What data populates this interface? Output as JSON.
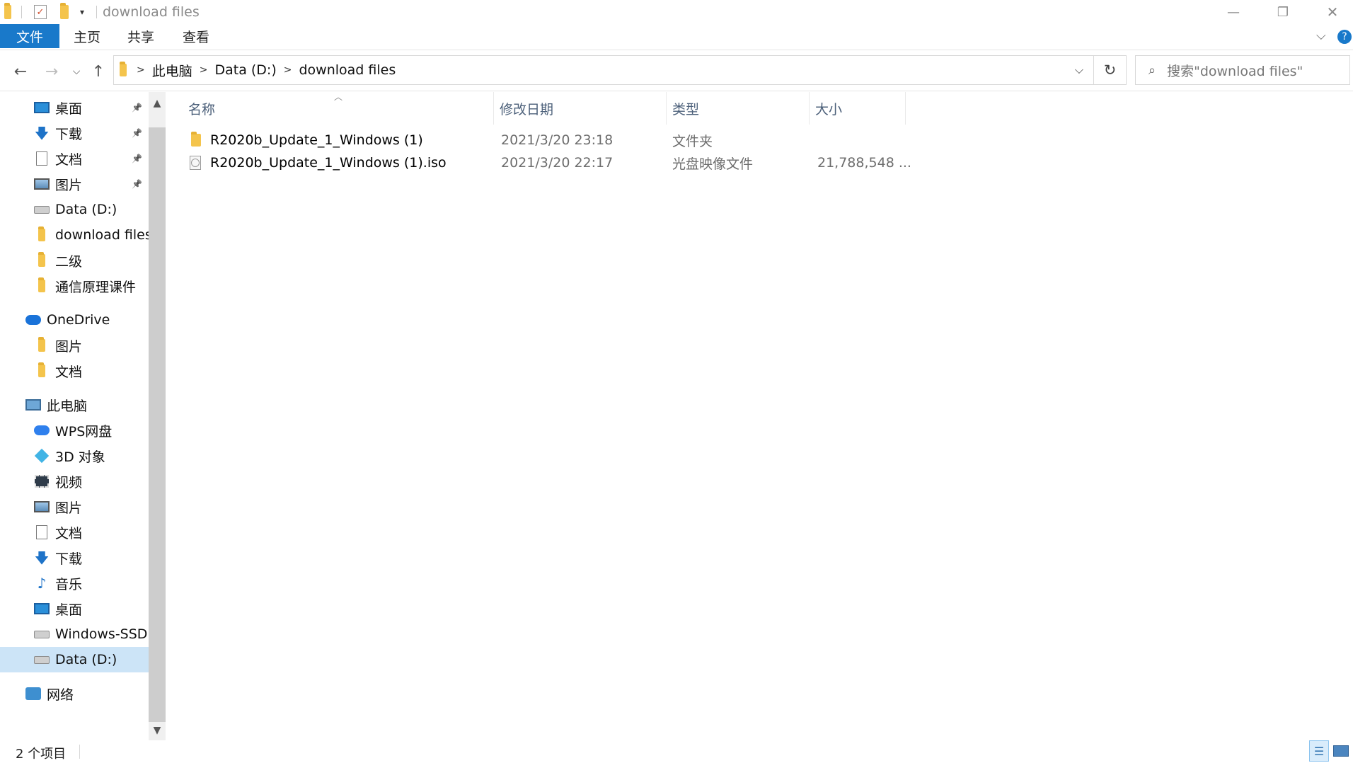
{
  "window": {
    "title": "download files",
    "minimize": "—",
    "restore": "❐",
    "close": "✕",
    "expand_ribbon": "⌵",
    "help": "?"
  },
  "ribbon": {
    "tabs": [
      "文件",
      "主页",
      "共享",
      "查看"
    ]
  },
  "address": {
    "crumbs": [
      "此电脑",
      "Data (D:)",
      "download files"
    ],
    "search_placeholder": "搜索\"download files\""
  },
  "sidebar": {
    "items": [
      {
        "label": "桌面",
        "icon": "desktop-icon",
        "pinned": true
      },
      {
        "label": "下载",
        "icon": "download-icon",
        "pinned": true
      },
      {
        "label": "文档",
        "icon": "document-icon",
        "pinned": true
      },
      {
        "label": "图片",
        "icon": "picture-icon",
        "pinned": true
      },
      {
        "label": "Data (D:)",
        "icon": "drive-icon",
        "pinned": false
      },
      {
        "label": "download files",
        "icon": "folder-icon",
        "pinned": false
      },
      {
        "label": "二级",
        "icon": "folder-icon",
        "pinned": false
      },
      {
        "label": "通信原理课件",
        "icon": "folder-icon",
        "pinned": false
      },
      {
        "label": "OneDrive",
        "icon": "onedrive-icon",
        "pinned": false
      },
      {
        "label": "图片",
        "icon": "folder-icon",
        "pinned": false
      },
      {
        "label": "文档",
        "icon": "folder-icon",
        "pinned": false
      },
      {
        "label": "此电脑",
        "icon": "this-pc-icon",
        "pinned": false
      },
      {
        "label": "WPS网盘",
        "icon": "cloud-icon",
        "pinned": false
      },
      {
        "label": "3D 对象",
        "icon": "3d-objects-icon",
        "pinned": false
      },
      {
        "label": "视频",
        "icon": "video-icon",
        "pinned": false
      },
      {
        "label": "图片",
        "icon": "picture-icon",
        "pinned": false
      },
      {
        "label": "文档",
        "icon": "document-icon",
        "pinned": false
      },
      {
        "label": "下载",
        "icon": "download-icon",
        "pinned": false
      },
      {
        "label": "音乐",
        "icon": "music-icon",
        "pinned": false
      },
      {
        "label": "桌面",
        "icon": "desktop-icon",
        "pinned": false
      },
      {
        "label": "Windows-SSD (",
        "icon": "windows-drive-icon",
        "pinned": false
      },
      {
        "label": "Data (D:)",
        "icon": "drive-icon",
        "pinned": false,
        "selected": true
      },
      {
        "label": "网络",
        "icon": "network-icon",
        "pinned": false
      }
    ]
  },
  "columns": [
    "名称",
    "修改日期",
    "类型",
    "大小"
  ],
  "files": [
    {
      "name": "R2020b_Update_1_Windows (1)",
      "date": "2021/3/20 23:18",
      "type": "文件夹",
      "size": "",
      "icon": "folder-icon"
    },
    {
      "name": "R2020b_Update_1_Windows (1).iso",
      "date": "2021/3/20 22:17",
      "type": "光盘映像文件",
      "size": "21,788,548 ...",
      "icon": "disc-image-icon"
    }
  ],
  "status": {
    "count": "2 个项目"
  }
}
